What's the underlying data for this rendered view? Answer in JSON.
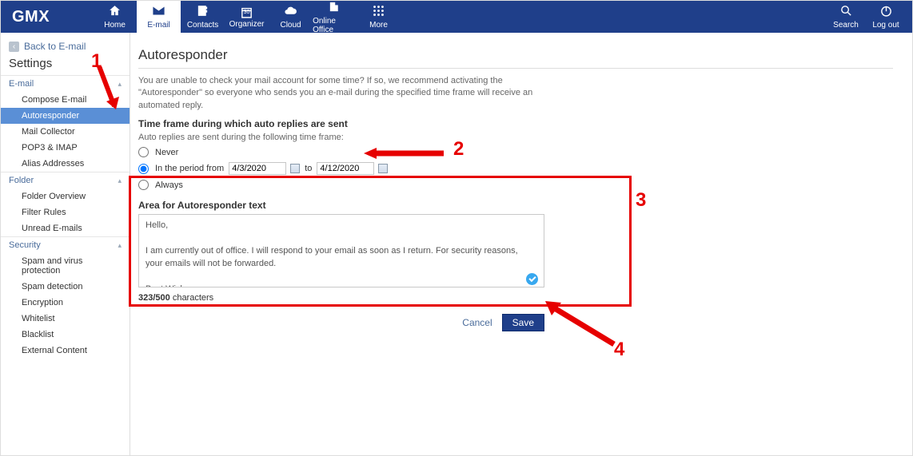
{
  "brand": "GMX",
  "nav": {
    "home": "Home",
    "email": "E-mail",
    "contacts": "Contacts",
    "organizer": "Organizer",
    "organizer_day": "30",
    "cloud": "Cloud",
    "online_office": "Online Office",
    "more": "More"
  },
  "topright": {
    "search": "Search",
    "logout": "Log out"
  },
  "sidebar": {
    "back": "Back to E-mail",
    "title": "Settings",
    "sections": {
      "email": {
        "header": "E-mail",
        "items": {
          "compose": "Compose E-mail",
          "autoresponder": "Autoresponder",
          "mail_collector": "Mail Collector",
          "pop3": "POP3 & IMAP",
          "alias": "Alias Addresses"
        }
      },
      "folder": {
        "header": "Folder",
        "items": {
          "overview": "Folder Overview",
          "filter": "Filter Rules",
          "unread": "Unread E-mails"
        }
      },
      "security": {
        "header": "Security",
        "items": {
          "spamvirus": "Spam and virus protection",
          "spamdet": "Spam detection",
          "encryption": "Encryption",
          "whitelist": "Whitelist",
          "blacklist": "Blacklist",
          "external": "External Content"
        }
      }
    }
  },
  "main": {
    "title": "Autoresponder",
    "intro": "You are unable to check your mail account for some time? If so, we recommend activating the \"Autoresponder\" so everyone who sends you an e-mail during the specified time frame will receive an automated reply.",
    "timeframe_header": "Time frame during which auto replies are sent",
    "timeframe_sub": "Auto replies are sent during the following time frame:",
    "options": {
      "never": "Never",
      "period_prefix": "In the period from",
      "period_to": "to",
      "always": "Always"
    },
    "dates": {
      "from": "4/3/2020",
      "to": "4/12/2020"
    },
    "area_label": "Area for Autoresponder text",
    "message": "Hello,\n\nI am currently out of office. I will respond to your email as soon as I return. For security reasons, your emails will not be forwarded.\n\nBest Wishes,\n\nJohn Smith",
    "counter_value": "323/500",
    "counter_suffix": " characters",
    "cancel": "Cancel",
    "save": "Save"
  },
  "annotations": {
    "n1": "1",
    "n2": "2",
    "n3": "3",
    "n4": "4"
  }
}
